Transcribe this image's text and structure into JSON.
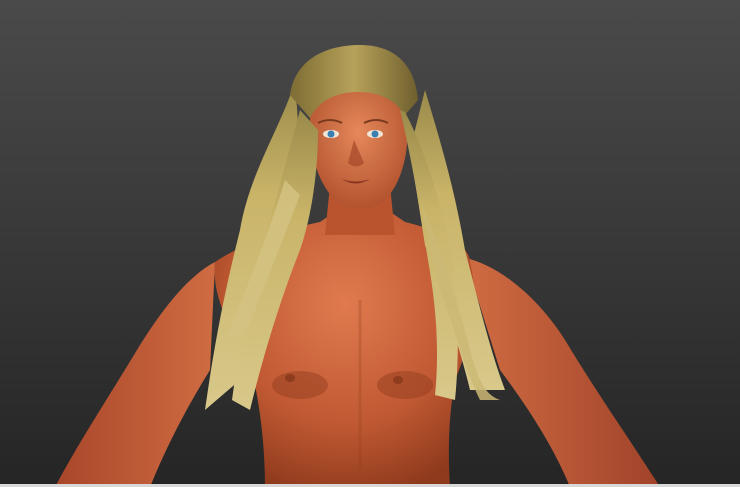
{
  "viewport": {
    "background_top": "#4a4a4a",
    "background_bottom": "#252525",
    "skin_color": "#c8603a",
    "hair_color": "#c9b468",
    "eye_color": "#3a7fb0"
  }
}
